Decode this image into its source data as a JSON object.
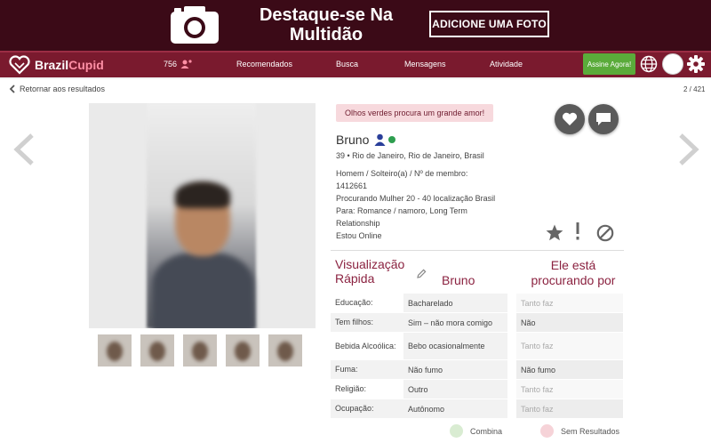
{
  "banner": {
    "title_line1": "Destaque-se Na",
    "title_line2": "Multidão",
    "button": "ADICIONE UMA FOTO"
  },
  "nav": {
    "logo_brazil": "Brazil",
    "logo_cupid": "Cupid",
    "count": "756",
    "links": [
      "Recomendados",
      "Busca",
      "Mensagens",
      "Atividade"
    ],
    "join": "Assine Agora!"
  },
  "profile": {
    "back": "Retornar aos resultados",
    "pager": "2 / 421",
    "tagline": "Olhos verdes procura um grande amor!",
    "name": "Bruno",
    "location": "39 • Rio de Janeiro, Rio de Janeiro, Brasil",
    "details": [
      "Homem / Solteiro(a) / Nº de membro:",
      "1412661",
      "Procurando Mulher 20 - 40 localização Brasil",
      "Para: Romance / namoro, Long Term",
      "Relationship",
      "Estou Online"
    ]
  },
  "quick": {
    "title_line1": "Visualização",
    "title_line2": "Rápida",
    "col_name": "Bruno",
    "col_seek_line1": "Ele está",
    "col_seek_line2": "procurando por",
    "rows": [
      {
        "label": "Educação:",
        "value": "Bacharelado",
        "seek": "Tanto faz"
      },
      {
        "label": "Tem filhos:",
        "value": "Sim – não mora comigo",
        "seek": "Não"
      },
      {
        "label": "Bebida Alcoólica:",
        "value": "Bebo ocasionalmente",
        "seek": "Tanto faz"
      },
      {
        "label": "Fuma:",
        "value": "Não fumo",
        "seek": "Não fumo"
      },
      {
        "label": "Religião:",
        "value": "Outro",
        "seek": "Tanto faz"
      },
      {
        "label": "Ocupação:",
        "value": "Autônomo",
        "seek": "Tanto faz"
      }
    ]
  },
  "legend": {
    "match": "Combina",
    "no_result": "Sem Resultados",
    "match_color": "#d9ecd2",
    "no_result_color": "#f6d3d8"
  },
  "colors": {
    "banner_bg": "#3b0a17",
    "nav_bg": "#7a1a2e",
    "accent": "#8b2240",
    "join_green": "#5aab3a"
  }
}
